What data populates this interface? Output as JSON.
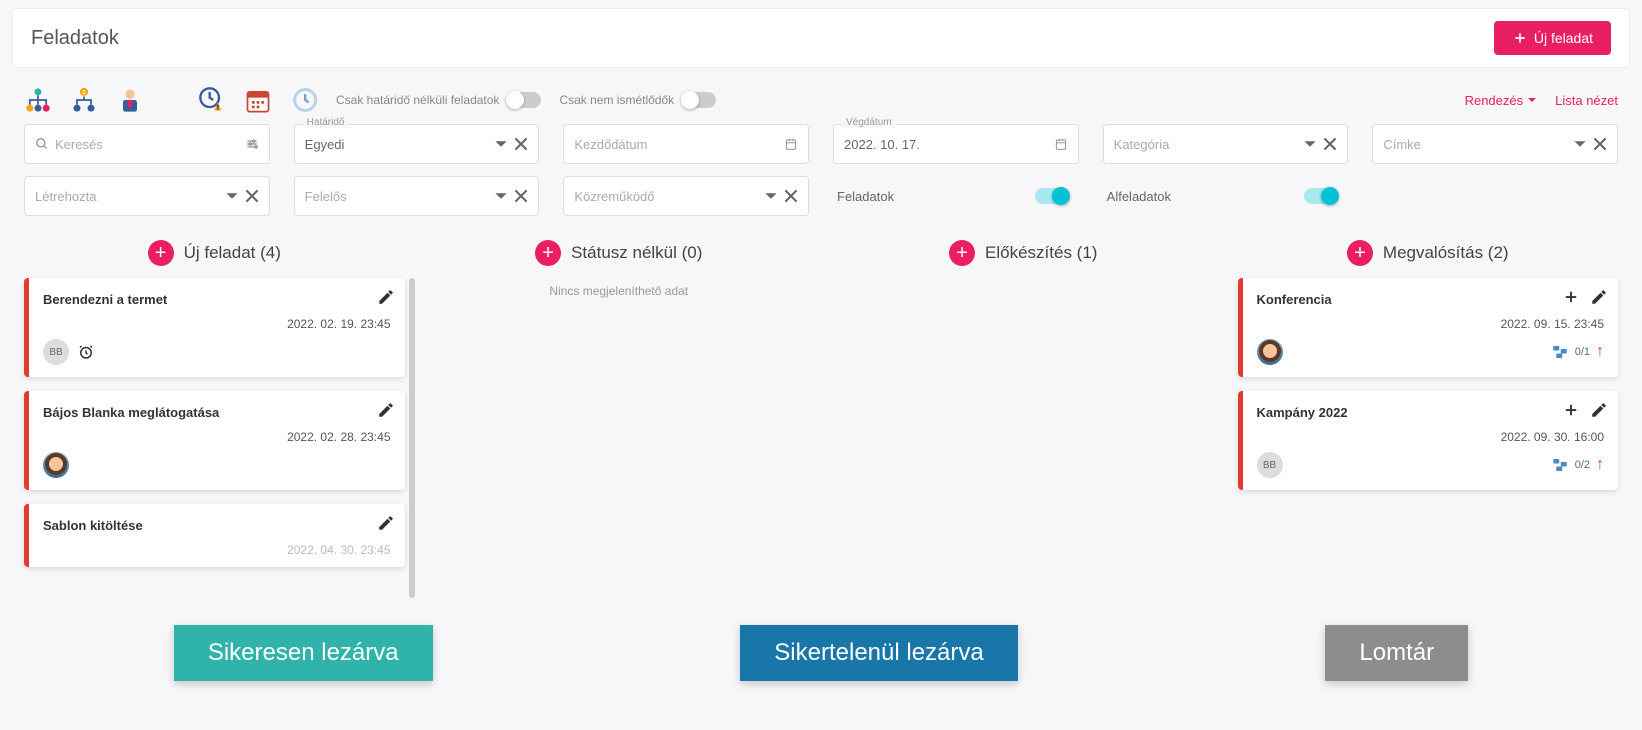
{
  "header": {
    "title": "Feladatok",
    "new_task_btn": "Új feladat"
  },
  "toolbar": {
    "toggle1_label": "Csak határidő nélküli feladatok",
    "toggle2_label": "Csak nem ismétlődők",
    "sort_label": "Rendezés",
    "list_view_label": "Lista nézet"
  },
  "filters": {
    "search_placeholder": "Keresés",
    "deadline_label": "Határidő",
    "deadline_value": "Egyedi",
    "start_date_placeholder": "Kezdődátum",
    "end_date_label": "Végdátum",
    "end_date_value": "2022. 10. 17.",
    "category_placeholder": "Kategória",
    "tag_placeholder": "Címke",
    "created_by_placeholder": "Létrehozta",
    "responsible_placeholder": "Felelős",
    "collaborator_placeholder": "Közreműködő",
    "tasks_label": "Feladatok",
    "subtasks_label": "Alfeladatok"
  },
  "columns": [
    {
      "title": "Új feladat (4)",
      "cards": [
        {
          "title": "Berendezni a termet",
          "date": "2022. 02. 19. 23:45",
          "avatar_type": "initials",
          "avatar_text": "BB",
          "alarm": true,
          "red": true
        },
        {
          "title": "Bájos Blanka meglátogatása",
          "date": "2022. 02. 28. 23:45",
          "avatar_type": "img",
          "red": true
        },
        {
          "title": "Sablon kitöltése",
          "date": "2022. 04. 30. 23:45",
          "red": true
        }
      ]
    },
    {
      "title": "Státusz nélkül (0)",
      "empty_text": "Nincs megjeleníthető adat",
      "cards": []
    },
    {
      "title": "Előkészítés (1)",
      "cards": []
    },
    {
      "title": "Megvalósítás (2)",
      "cards": [
        {
          "title": "Konferencia",
          "date": "2022. 09. 15. 23:45",
          "avatar_type": "img",
          "sub_count": "0/1",
          "has_plus": true,
          "red": true,
          "arrow": true
        },
        {
          "title": "Kampány 2022",
          "date": "2022. 09. 30. 16:00",
          "avatar_type": "initials",
          "avatar_text": "BB",
          "sub_count": "0/2",
          "has_plus": true,
          "red": true,
          "arrow": true
        }
      ]
    }
  ],
  "dropzones": {
    "success": "Sikeresen lezárva",
    "fail": "Sikertelenül lezárva",
    "trash": "Lomtár"
  }
}
